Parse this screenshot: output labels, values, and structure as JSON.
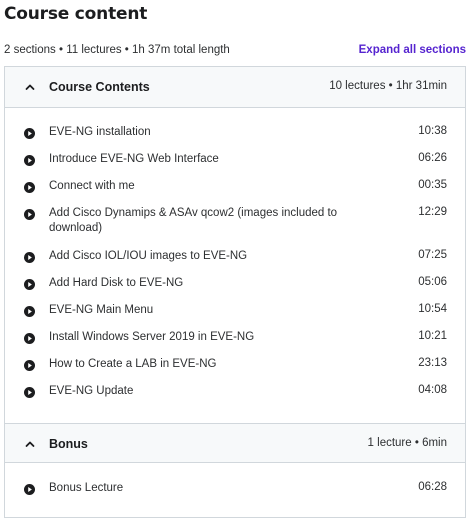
{
  "header": {
    "title": "Course content",
    "summary": "2 sections • 11 lectures • 1h 37m total length",
    "expand_all": "Expand all sections"
  },
  "sections": [
    {
      "title": "Course Contents",
      "meta": "10 lectures • 1hr 31min",
      "lectures": [
        {
          "title": "EVE-NG installation",
          "duration": "10:38"
        },
        {
          "title": "Introduce EVE-NG Web Interface",
          "duration": "06:26"
        },
        {
          "title": "Connect with me",
          "duration": "00:35"
        },
        {
          "title": "Add Cisco Dynamips & ASAv qcow2 (images included to download)",
          "duration": "12:29"
        },
        {
          "title": "Add Cisco IOL/IOU images to EVE-NG",
          "duration": "07:25"
        },
        {
          "title": "Add Hard Disk to EVE-NG",
          "duration": "05:06"
        },
        {
          "title": "EVE-NG Main Menu",
          "duration": "10:54"
        },
        {
          "title": "Install Windows Server 2019 in EVE-NG",
          "duration": "10:21"
        },
        {
          "title": "How to Create a LAB in EVE-NG",
          "duration": "23:13"
        },
        {
          "title": "EVE-NG Update",
          "duration": "04:08"
        }
      ]
    },
    {
      "title": "Bonus",
      "meta": "1 lecture • 6min",
      "lectures": [
        {
          "title": "Bonus Lecture",
          "duration": "06:28"
        }
      ]
    }
  ],
  "icons": {
    "section_toggle": "chevron-up-icon",
    "lecture_type": "play-circle-icon"
  },
  "colors": {
    "link": "#5624d0",
    "text": "#1c1d1f",
    "section_bg": "#f7f9fa",
    "border": "#d1d7dc"
  }
}
